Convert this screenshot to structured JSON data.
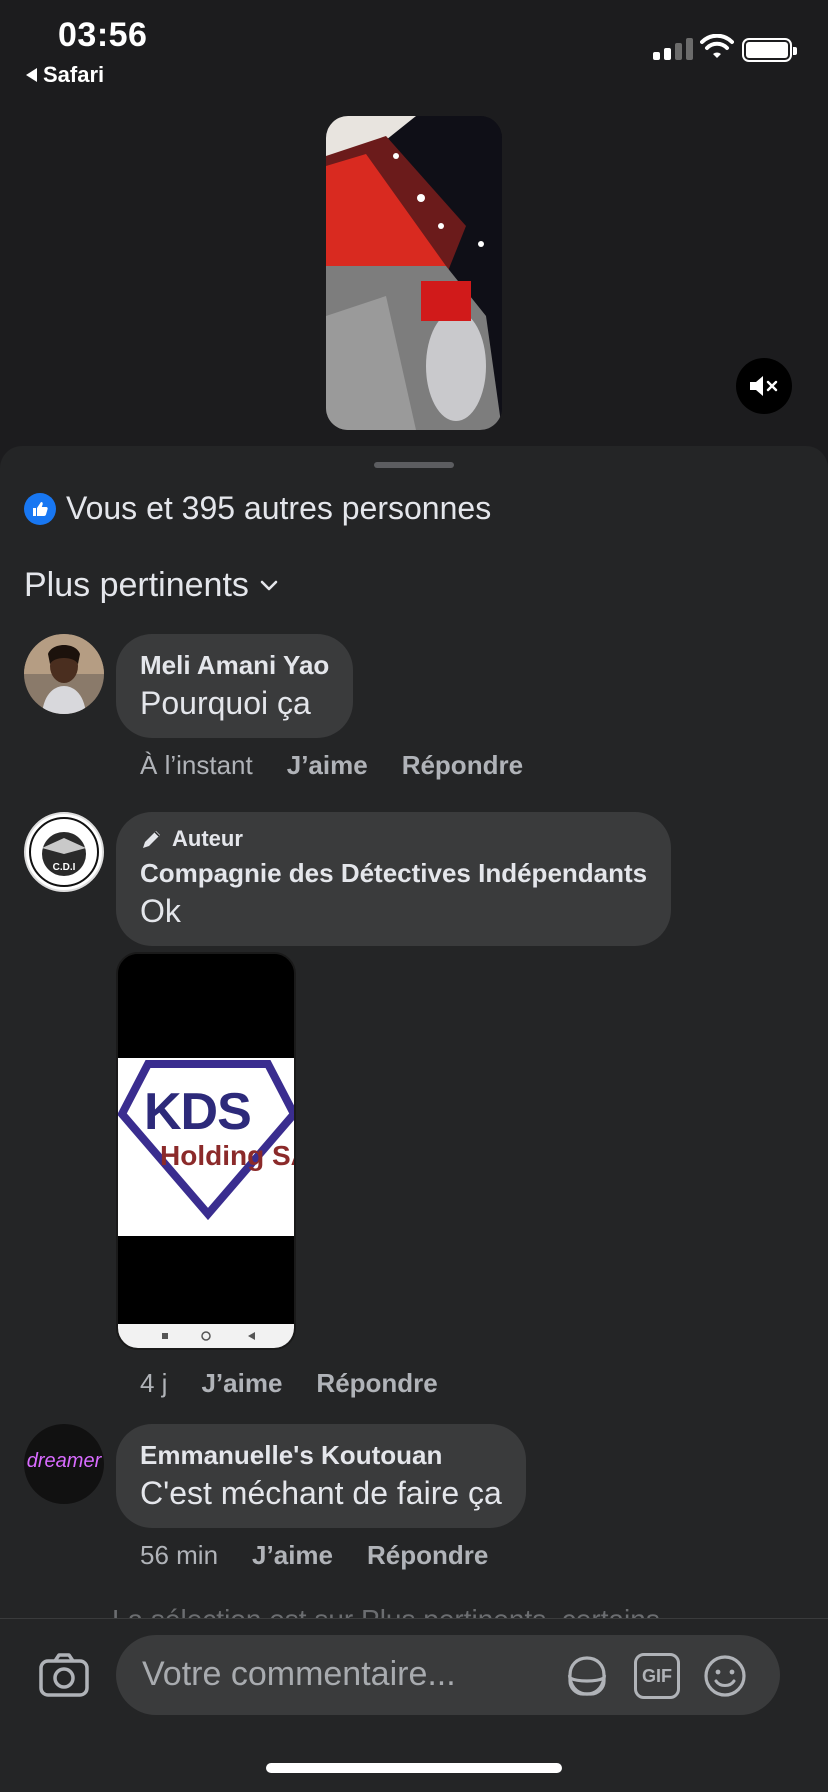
{
  "status_bar": {
    "time": "03:56",
    "back_app": "Safari"
  },
  "reactions": {
    "text": "Vous et 395 autres personnes"
  },
  "sort": {
    "label": "Plus pertinents"
  },
  "comments": [
    {
      "author": "Meli Amani Yao",
      "text": "Pourquoi ça",
      "time": "À l’instant",
      "like": "J’aime",
      "reply": "Répondre"
    },
    {
      "badge": "Auteur",
      "author": "Compagnie des Détectives Indépendants",
      "text": "Ok",
      "attachment": {
        "line1": "KDS",
        "line2": "Holding SA"
      },
      "avatar_text": "C.D.I",
      "time": "4 j",
      "like": "J’aime",
      "reply": "Répondre"
    },
    {
      "author": "Emmanuelle's Koutouan",
      "text": "C'est méchant de faire ça",
      "avatar_text": "dreamer",
      "time": "56 min",
      "like": "J’aime",
      "reply": "Répondre"
    }
  ],
  "faded_notice": "La sélection est sur Plus pertinents, certains",
  "composer": {
    "placeholder": "Votre commentaire...",
    "gif_label": "GIF"
  },
  "colors": {
    "accent": "#1877f2",
    "sheet": "#242526",
    "bubble": "#3a3b3c"
  },
  "icons": [
    "like-icon",
    "chevron-down-icon",
    "mute-icon",
    "pencil-icon",
    "camera-icon",
    "sticker-icon",
    "gif-icon",
    "emoji-icon"
  ]
}
